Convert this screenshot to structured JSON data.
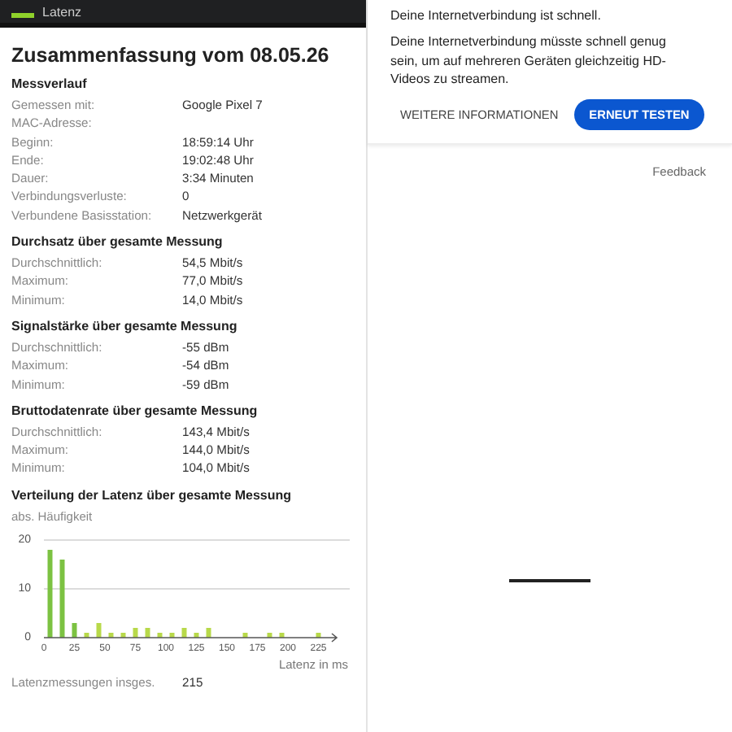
{
  "header": {
    "title": "Latenz"
  },
  "summary": {
    "title": "Zusammenfassung vom 08.05.26",
    "sections": [
      {
        "heading": "Messverlauf",
        "rows": [
          {
            "label": "Gemessen mit:",
            "value": "Google Pixel 7"
          },
          {
            "label": "MAC-Adresse:"
          },
          {
            "label": "Beginn:",
            "value": "18:59:14 Uhr"
          },
          {
            "label": "Ende:",
            "value": "19:02:48 Uhr"
          },
          {
            "label": "Dauer:",
            "value": "3:34 Minuten"
          },
          {
            "label": "Verbindungsverluste:",
            "value": "0"
          },
          {
            "label": "Verbundene Basisstation:",
            "value": "Netzwerkgerät"
          }
        ]
      },
      {
        "heading": "Durchsatz über gesamte Messung",
        "rows": [
          {
            "label": "Durchschnittlich:",
            "value": "54,5 Mbit/s"
          },
          {
            "label": "Maximum:",
            "value": "77,0 Mbit/s"
          },
          {
            "label": "Minimum:",
            "value": "14,0 Mbit/s"
          }
        ]
      },
      {
        "heading": "Signalstärke über gesamte Messung",
        "rows": [
          {
            "label": "Durchschnittlich:",
            "value": "-55 dBm"
          },
          {
            "label": "Maximum:",
            "value": "-54 dBm"
          },
          {
            "label": "Minimum:",
            "value": "-59 dBm"
          }
        ]
      },
      {
        "heading": "Bruttodatenrate über gesamte Messung",
        "rows": [
          {
            "label": "Durchschnittlich:",
            "value": "143,4 Mbit/s"
          },
          {
            "label": "Maximum:",
            "value": "144,0 Mbit/s"
          },
          {
            "label": "Minimum:",
            "value": "104,0 Mbit/s"
          }
        ]
      }
    ],
    "distribution": {
      "heading": "Verteilung der Latenz über gesamte Messung",
      "chart_data": {
        "type": "bar",
        "ylabel": "abs. Häufigkeit",
        "xlabel": "Latenz in ms",
        "x": [
          5,
          15,
          25,
          35,
          45,
          55,
          65,
          75,
          85,
          95,
          105,
          115,
          125,
          135,
          165,
          185,
          195,
          225
        ],
        "values": [
          18,
          16,
          3,
          1,
          3,
          1,
          1,
          2,
          2,
          1,
          1,
          2,
          1,
          2,
          1,
          1,
          1,
          1
        ],
        "xlim": [
          0,
          240
        ],
        "ylim": [
          0,
          20
        ],
        "xticks": [
          0,
          25,
          50,
          75,
          100,
          125,
          150,
          175,
          200,
          225
        ],
        "yticks": [
          0,
          10,
          20
        ]
      }
    },
    "footer_row": {
      "label": "Latenzmessungen insges.",
      "value": "215"
    }
  },
  "speedtest": {
    "status": "Deine Internetverbindung ist schnell.",
    "detail": "Deine Internetverbindung müsste schnell genug sein, um auf mehreren Geräten gleichzeitig HD-Videos zu streamen.",
    "buttons": [
      {
        "label": "WEITERE INFORMATIONEN",
        "kind": "text"
      },
      {
        "label": "ERNEUT TESTEN",
        "kind": "filled"
      }
    ],
    "feedback": "Feedback"
  }
}
